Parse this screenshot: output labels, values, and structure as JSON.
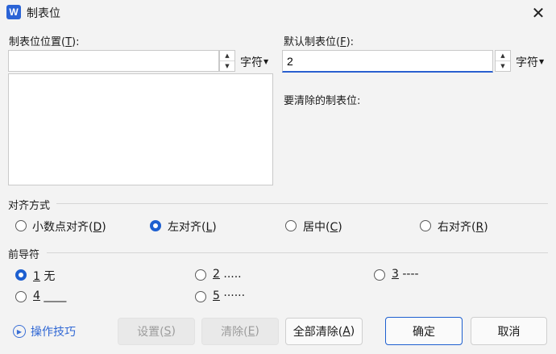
{
  "window": {
    "app_icon": "W",
    "title": "制表位",
    "close_glyph": "✕"
  },
  "tab_position": {
    "label": "制表位位置(",
    "label_key": "T",
    "label_end": "):",
    "value": "",
    "unit": "字符",
    "list_items": []
  },
  "default_tab": {
    "label": "默认制表位(",
    "label_key": "F",
    "label_end": "):",
    "value": "2",
    "unit": "字符"
  },
  "clear_label": "要清除的制表位:",
  "alignment": {
    "title": "对齐方式",
    "options": [
      {
        "label": "小数点对齐(",
        "key": "D",
        "end": ")",
        "selected": false
      },
      {
        "label": "左对齐(",
        "key": "L",
        "end": ")",
        "selected": true
      },
      {
        "label": "居中(",
        "key": "C",
        "end": ")",
        "selected": false
      },
      {
        "label": "右对齐(",
        "key": "R",
        "end": ")",
        "selected": false
      }
    ]
  },
  "leader": {
    "title": "前导符",
    "options": [
      {
        "key": "1",
        "text": " 无",
        "selected": true
      },
      {
        "key": "2",
        "text": " .....",
        "selected": false
      },
      {
        "key": "3",
        "text": " ----",
        "selected": false
      },
      {
        "key": "4",
        "text": " ____",
        "selected": false
      },
      {
        "key": "5",
        "text": " ······",
        "selected": false
      }
    ]
  },
  "footer": {
    "tips": "操作技巧",
    "set_label": "设置(",
    "set_key": "S",
    "clear_label": "清除(",
    "clear_key": "E",
    "clear_all_label": "全部清除(",
    "clear_all_key": "A",
    "paren_close": ")",
    "ok": "确定",
    "cancel": "取消"
  },
  "colors": {
    "accent": "#1d5fd0",
    "background": "#f3f3f3"
  }
}
